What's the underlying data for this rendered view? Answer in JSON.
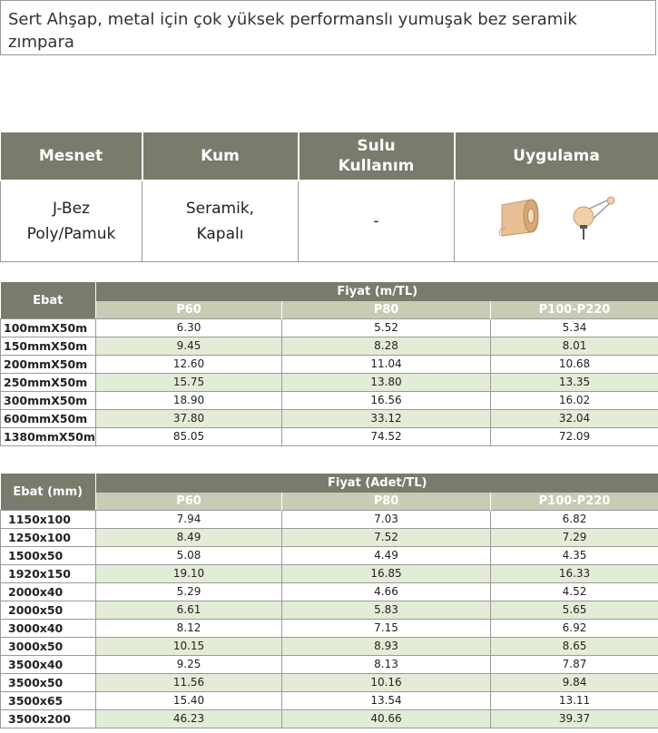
{
  "title": "Sert Ahşap, metal için çok yüksek performanslı yumuşak bez seramik zımpara",
  "spec": {
    "headers": [
      "Mesnet",
      "Kum",
      "Sulu Kullanım",
      "Uygulama"
    ],
    "mesnet_line1": "J-Bez",
    "mesnet_line2": "Poly/Pamuk",
    "kum_line1": "Seramik,",
    "kum_line2": "Kapalı",
    "sulu": "-",
    "uygulama_icons": [
      "abrasive-roll-icon",
      "pulley-wheel-icon"
    ]
  },
  "table1": {
    "ebat_label": "Ebat",
    "group_label": "Fiyat (m/TL)",
    "columns": [
      "P60",
      "P80",
      "P100-P220"
    ],
    "rows": [
      {
        "size": "100mmX50m",
        "p60": "6.30",
        "p80": "5.52",
        "p100": "5.34"
      },
      {
        "size": "150mmX50m",
        "p60": "9.45",
        "p80": "8.28",
        "p100": "8.01"
      },
      {
        "size": "200mmX50m",
        "p60": "12.60",
        "p80": "11.04",
        "p100": "10.68"
      },
      {
        "size": "250mmX50m",
        "p60": "15.75",
        "p80": "13.80",
        "p100": "13.35"
      },
      {
        "size": "300mmX50m",
        "p60": "18.90",
        "p80": "16.56",
        "p100": "16.02"
      },
      {
        "size": "600mmX50m",
        "p60": "37.80",
        "p80": "33.12",
        "p100": "32.04"
      },
      {
        "size": "1380mmX50m",
        "p60": "85.05",
        "p80": "74.52",
        "p100": "72.09"
      }
    ]
  },
  "table2": {
    "ebat_label": "Ebat (mm)",
    "group_label": "Fiyat (Adet/TL)",
    "columns": [
      "P60",
      "P80",
      "P100-P220"
    ],
    "rows": [
      {
        "size": "1150x100",
        "p60": "7.94",
        "p80": "7.03",
        "p100": "6.82"
      },
      {
        "size": "1250x100",
        "p60": "8.49",
        "p80": "7.52",
        "p100": "7.29"
      },
      {
        "size": "1500x50",
        "p60": "5.08",
        "p80": "4.49",
        "p100": "4.35"
      },
      {
        "size": "1920x150",
        "p60": "19.10",
        "p80": "16.85",
        "p100": "16.33"
      },
      {
        "size": "2000x40",
        "p60": "5.29",
        "p80": "4.66",
        "p100": "4.52"
      },
      {
        "size": "2000x50",
        "p60": "6.61",
        "p80": "5.83",
        "p100": "5.65"
      },
      {
        "size": "3000x40",
        "p60": "8.12",
        "p80": "7.15",
        "p100": "6.92"
      },
      {
        "size": "3000x50",
        "p60": "10.15",
        "p80": "8.93",
        "p100": "8.65"
      },
      {
        "size": "3500x40",
        "p60": "9.25",
        "p80": "8.13",
        "p100": "7.87"
      },
      {
        "size": "3500x50",
        "p60": "11.56",
        "p80": "10.16",
        "p100": "9.84"
      },
      {
        "size": "3500x65",
        "p60": "15.40",
        "p80": "13.54",
        "p100": "13.11"
      },
      {
        "size": "3500x200",
        "p60": "46.23",
        "p80": "40.66",
        "p100": "39.37"
      }
    ]
  }
}
